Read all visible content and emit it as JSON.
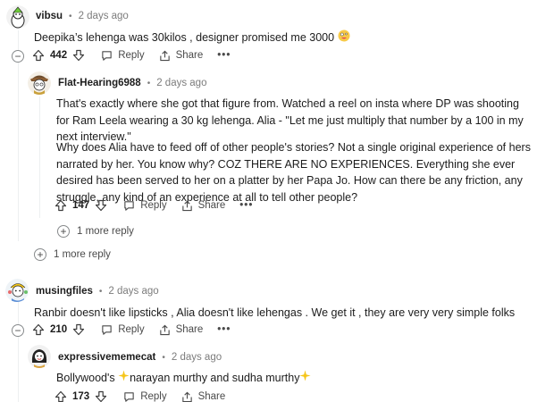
{
  "comments": [
    {
      "author": "vibsu",
      "time": "2 days ago",
      "text": "Deepika’s lehenga was 30kilos , designer promised me 3000",
      "text_emoji": "crazy-face",
      "score": "442",
      "reply_label": "Reply",
      "share_label": "Share",
      "more_label": "•••"
    },
    {
      "author": "Flat-Hearing6988",
      "time": "2 days ago",
      "paragraph1": "That's exactly where she got that figure from. Watched a reel on insta where DP was shooting for Ram Leela wearing a 30 kg lehenga. Alia - \"Let me just multiply that number by a 100 in my next interview.\"",
      "paragraph2": "Why does Alia have to feed off of other people's stories? Not a single original experience of hers narrated by her. You know why? COZ THERE ARE NO EXPERIENCES. Everything she ever desired has been served to her on a platter by her Papa Jo. How can there be any friction, any struggle, any kind of an experience at all to tell other people?",
      "score": "147",
      "reply_label": "Reply",
      "share_label": "Share",
      "more_label": "•••",
      "more_replies": "1 more reply"
    },
    {
      "more_replies": "1 more reply"
    },
    {
      "author": "musingfiles",
      "time": "2 days ago",
      "text": "Ranbir doesn't like lipsticks , Alia doesn't like lehengas . We get it , they are very very simple folks",
      "score": "210",
      "reply_label": "Reply",
      "share_label": "Share",
      "more_label": "•••"
    },
    {
      "author": "expressivememecat",
      "time": "2 days ago",
      "text_before": "Bollywood's ",
      "text_middle": "narayan murthy and sudha murthy",
      "score": "173",
      "reply_label": "Reply",
      "share_label": "Share"
    }
  ],
  "icons": {
    "upvote": "arrow-up-icon",
    "downvote": "arrow-down-icon",
    "reply": "speech-bubble-icon",
    "share": "share-icon",
    "sparkle": "sparkles-emoji",
    "collapse": "minus-circle-icon",
    "expand": "plus-circle-icon"
  },
  "colors": {
    "text": "#1c1c1c",
    "muted": "#7c7c7c",
    "thread_line": "#edeff1",
    "sparkle": "#f5c518"
  }
}
